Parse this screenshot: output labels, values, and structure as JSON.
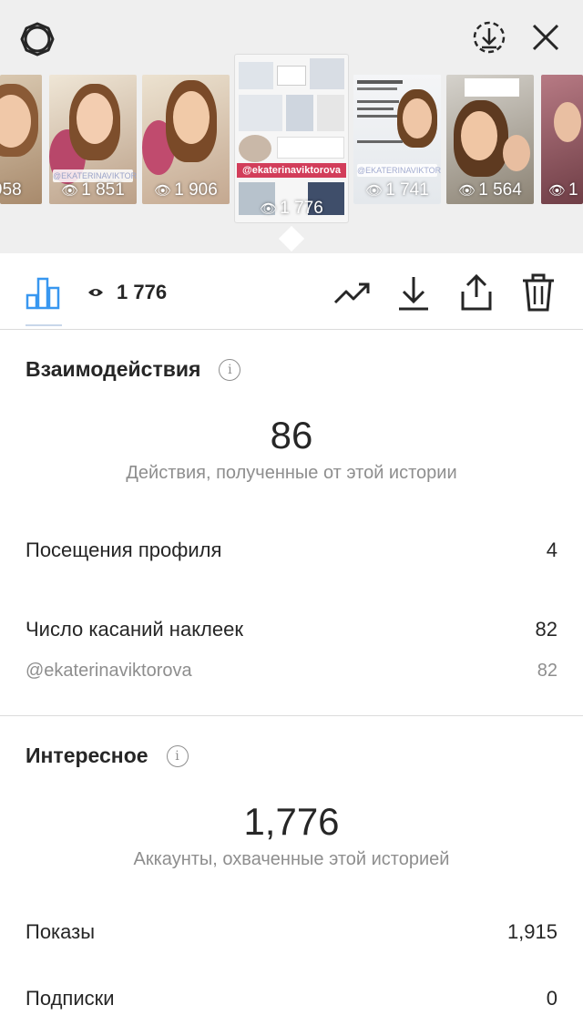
{
  "top": {
    "settings_icon": "gear-icon",
    "download_icon": "download-circle-icon",
    "close_icon": "close-icon"
  },
  "stories": [
    {
      "count": "958"
    },
    {
      "count": "1 851",
      "tag": "@EKATERINAVIKTOROVA"
    },
    {
      "count": "1 906"
    },
    {
      "count": "1 776",
      "tag": "@ekaterinaviktorova"
    },
    {
      "count": "1 741",
      "tag": "@EKATERINAVIKTOROVA"
    },
    {
      "count": "1 564"
    },
    {
      "count": "1"
    }
  ],
  "actionbar": {
    "views": "1 776",
    "chart_icon": "bar-chart-icon",
    "eye_icon": "eye-icon",
    "trend_icon": "trending-up-icon",
    "download_icon": "download-icon",
    "share_icon": "share-icon",
    "delete_icon": "trash-icon"
  },
  "interactions": {
    "title": "Взаимодействия",
    "total": "86",
    "total_label": "Действия, полученные от этой истории",
    "profile_visits_label": "Посещения профиля",
    "profile_visits_value": "4",
    "sticker_taps_label": "Число касаний наклеек",
    "sticker_taps_value": "82",
    "sticker_handle": "@ekaterinaviktorova",
    "sticker_handle_value": "82"
  },
  "discovery": {
    "title": "Интересное",
    "total": "1,776",
    "total_label": "Аккаунты, охваченные этой историей",
    "impressions_label": "Показы",
    "impressions_value": "1,915",
    "follows_label": "Подписки",
    "follows_value": "0"
  },
  "colors": {
    "accent": "#3897f0",
    "text": "#262626",
    "secondary": "#8e8e8e",
    "divider": "#dbdbdb"
  }
}
